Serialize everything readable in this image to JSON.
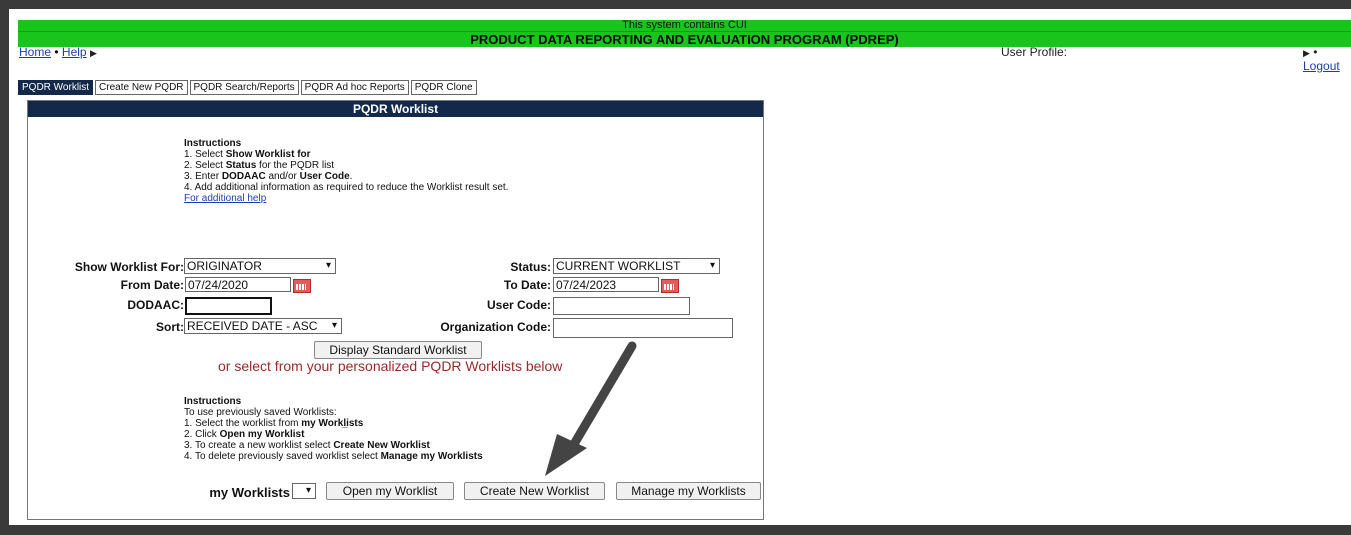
{
  "banner": {
    "cui": "This system contains CUI",
    "title": "PRODUCT DATA REPORTING AND EVALUATION PROGRAM (PDREP)"
  },
  "topnav": {
    "home": "Home",
    "sep": "•",
    "help": "Help",
    "user_profile": "User Profile:",
    "logout": "Logout"
  },
  "tabs": [
    {
      "label": "PQDR Worklist",
      "active": true
    },
    {
      "label": "Create New PQDR",
      "active": false
    },
    {
      "label": "PQDR Search/Reports",
      "active": false
    },
    {
      "label": "PQDR Ad hoc Reports",
      "active": false
    },
    {
      "label": "PQDR Clone",
      "active": false
    }
  ],
  "panel": {
    "title": "PQDR Worklist",
    "instructions1": {
      "heading": "Instructions",
      "l1a": "1. Select ",
      "l1b": "Show Worklist for",
      "l2a": "2. Select ",
      "l2b": "Status",
      "l2c": " for the PQDR list",
      "l3a": "3. Enter ",
      "l3b": "DODAAC",
      "l3c": " and/or ",
      "l3d": "User Code",
      "l3e": ".",
      "l4": "4. Add additional information as required to reduce the Worklist result set.",
      "help_link": "For additional help"
    },
    "form": {
      "show_worklist_label": "Show Worklist For:",
      "show_worklist_value": "ORIGINATOR",
      "status_label": "Status:",
      "status_value": "CURRENT WORKLIST",
      "from_label": "From Date:",
      "from_value": "07/24/2020",
      "to_label": "To Date:",
      "to_value": "07/24/2023",
      "dodaac_label": "DODAAC:",
      "dodaac_value": "",
      "usercode_label": "User Code:",
      "usercode_value": "",
      "sort_label": "Sort:",
      "sort_value": "RECEIVED DATE - ASC",
      "org_label": "Organization Code:",
      "org_value": "",
      "display_btn": "Display Standard Worklist",
      "or_text": "or select from your personalized PQDR Worklists below"
    },
    "instructions2": {
      "heading": "Instructions",
      "intro": "To use previously saved Worklists:",
      "l1a": "1. Select the worklist from ",
      "l1b": "my Workl̲ists",
      "l2a": "2. Click ",
      "l2b": "Open my Worklist",
      "l3a": "3. To create a new worklist select ",
      "l3b": "Create New Worklist",
      "l4a": "4. To delete previously saved worklist select ",
      "l4b": "Manage my Worklists"
    },
    "bottom": {
      "my_worklists_label": "my Worklists",
      "open_btn": "Open my Worklist",
      "create_btn": "Create New Worklist",
      "manage_btn": "Manage my Worklists"
    }
  },
  "colors": {
    "banner_green": "#19c41d",
    "navy": "#13294b",
    "link": "#1c3fb0",
    "red_text": "#9a2a2a"
  }
}
